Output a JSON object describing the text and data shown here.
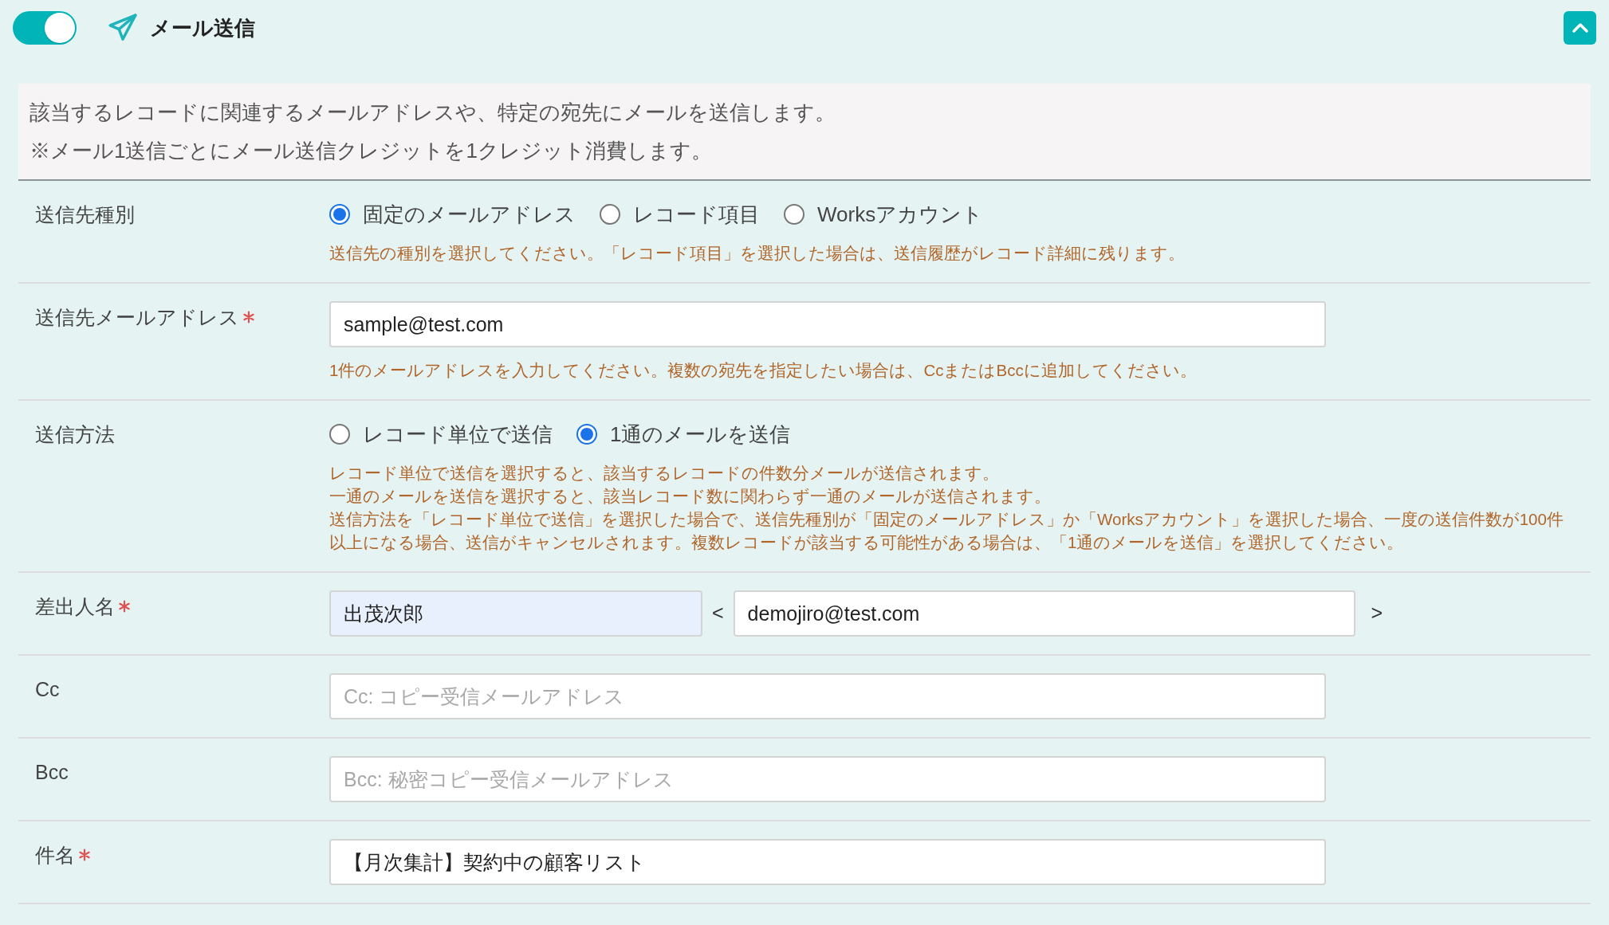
{
  "header": {
    "enabled": true,
    "title": "メール送信",
    "expanded": true
  },
  "description": [
    "該当するレコードに関連するメールアドレスや、特定の宛先にメールを送信します。",
    "※メール1送信ごとにメール送信クレジットを1クレジット消費します。"
  ],
  "fields": [
    {
      "kind": "radio",
      "label": "送信先種別",
      "required": false,
      "options": [
        {
          "label": "固定のメールアドレス",
          "selected": true
        },
        {
          "label": "レコード項目",
          "selected": false
        },
        {
          "label": "Worksアカウント",
          "selected": false
        }
      ],
      "hints": [
        "送信先の種別を選択してください。「レコード項目」を選択した場合は、送信履歴がレコード詳細に残ります。"
      ]
    },
    {
      "kind": "text",
      "label": "送信先メールアドレス",
      "required": true,
      "value": "sample@test.com",
      "hints": [
        "1件のメールアドレスを入力してください。複数の宛先を指定したい場合は、CcまたはBccに追加してください。"
      ]
    },
    {
      "kind": "radio",
      "label": "送信方法",
      "required": false,
      "options": [
        {
          "label": "レコード単位で送信",
          "selected": false
        },
        {
          "label": "1通のメールを送信",
          "selected": true
        }
      ],
      "hints": [
        "レコード単位で送信を選択すると、該当するレコードの件数分メールが送信されます。",
        "一通のメールを送信を選択すると、該当レコード数に関わらず一通のメールが送信されます。",
        "送信方法を「レコード単位で送信」を選択した場合で、送信先種別が「固定のメールアドレス」か「Worksアカウント」を選択した場合、一度の送信件数が100件以上になる場合、送信がキャンセルされます。複数レコードが該当する可能性がある場合は、「1通のメールを送信」を選択してください。"
      ]
    },
    {
      "kind": "sender",
      "label": "差出人名",
      "required": true,
      "name": "出茂次郎",
      "open": "<",
      "email": "demojiro@test.com",
      "close": ">"
    },
    {
      "kind": "text",
      "label": "Cc",
      "required": false,
      "placeholder": "Cc: コピー受信メールアドレス"
    },
    {
      "kind": "text",
      "label": "Bcc",
      "required": false,
      "placeholder": "Bcc: 秘密コピー受信メールアドレス"
    },
    {
      "kind": "text",
      "label": "件名",
      "required": true,
      "value": "【月次集計】契約中の顧客リスト"
    }
  ]
}
